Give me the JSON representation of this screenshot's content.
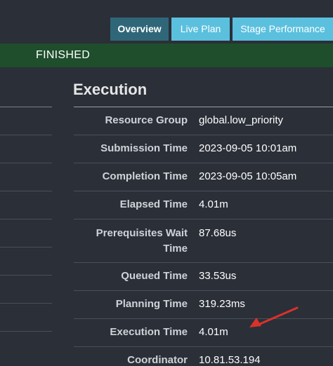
{
  "tabs": [
    {
      "label": "Overview",
      "active": true
    },
    {
      "label": "Live Plan",
      "active": false
    },
    {
      "label": "Stage Performance",
      "active": false
    }
  ],
  "status": {
    "text": "FINISHED",
    "color": "#1e4e2c"
  },
  "section": {
    "title": "Execution"
  },
  "rows": [
    {
      "label": "Resource Group",
      "value": "global.low_priority"
    },
    {
      "label": "Submission Time",
      "value": "2023-09-05 10:01am"
    },
    {
      "label": "Completion Time",
      "value": "2023-09-05 10:05am"
    },
    {
      "label": "Elapsed Time",
      "value": "4.01m"
    },
    {
      "label": "Prerequisites Wait Time",
      "value": "87.68us"
    },
    {
      "label": "Queued Time",
      "value": "33.53us"
    },
    {
      "label": "Planning Time",
      "value": "319.23ms"
    },
    {
      "label": "Execution Time",
      "value": "4.01m"
    },
    {
      "label": "Coordinator",
      "value": "10.81.53.194"
    }
  ],
  "colors": {
    "accent_tab": "#5bc0de",
    "active_tab": "#2f6779",
    "annotation_arrow": "#d9322b"
  }
}
